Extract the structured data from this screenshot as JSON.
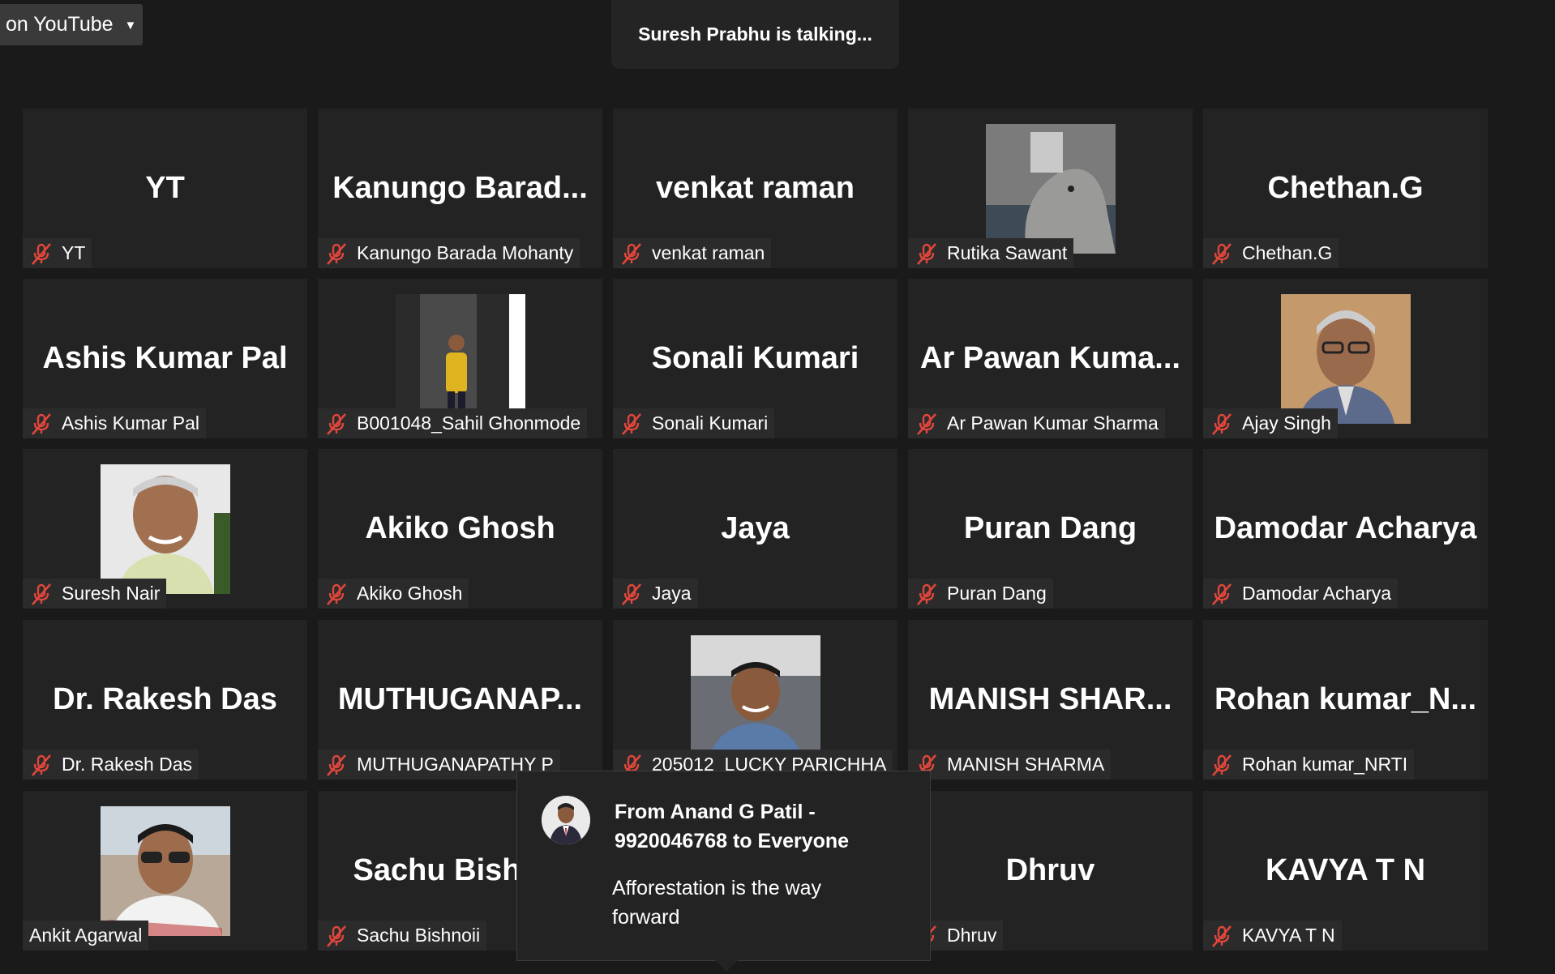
{
  "live_stream": {
    "label": "on YouTube"
  },
  "speaker": {
    "text": "Suresh Prabhu is talking..."
  },
  "tiles": [
    {
      "big": "YT",
      "label": "YT"
    },
    {
      "big": "Kanungo  Barad...",
      "label": "Kanungo Barada Mohanty"
    },
    {
      "big": "venkat raman",
      "label": "venkat raman"
    },
    {
      "big": "",
      "label": "Rutika Sawant"
    },
    {
      "big": "Chethan.G",
      "label": "Chethan.G"
    },
    {
      "big": "Ashis Kumar Pal",
      "label": "Ashis Kumar Pal"
    },
    {
      "big": "",
      "label": "B001048_Sahil Ghonmode"
    },
    {
      "big": "Sonali Kumari",
      "label": "Sonali Kumari"
    },
    {
      "big": "Ar  Pawan  Kuma...",
      "label": "Ar Pawan Kumar Sharma"
    },
    {
      "big": "",
      "label": "Ajay Singh"
    },
    {
      "big": "",
      "label": "Suresh Nair"
    },
    {
      "big": "Akiko  Ghosh",
      "label": "Akiko  Ghosh"
    },
    {
      "big": "Jaya",
      "label": "Jaya"
    },
    {
      "big": "Puran Dang",
      "label": "Puran Dang"
    },
    {
      "big": "Damodar Acharya",
      "label": "Damodar Acharya"
    },
    {
      "big": "Dr. Rakesh Das",
      "label": "Dr. Rakesh Das"
    },
    {
      "big": "MUTHUGANAP...",
      "label": "MUTHUGANAPATHY P"
    },
    {
      "big": "",
      "label": "205012_LUCKY PARICHHA"
    },
    {
      "big": "MANISH  SHAR...",
      "label": "MANISH SHARMA"
    },
    {
      "big": "Rohan  kumar_N...",
      "label": "Rohan kumar_NRTI"
    },
    {
      "big": "",
      "label": "Ankit Agarwal"
    },
    {
      "big": "Sachu Bishnoi",
      "label": "Sachu Bishnoii"
    },
    {
      "big": "",
      "label": ""
    },
    {
      "big": "Dhruv",
      "label": "Dhruv"
    },
    {
      "big": "KAVYA T N",
      "label": "KAVYA T N"
    }
  ],
  "chat": {
    "from": "From Anand G Patil - 9920046768 to Everyone",
    "message": "Afforestation is the way forward"
  },
  "colors": {
    "background": "#1a1a1a",
    "tile": "#232323",
    "mute": "#e0463b"
  }
}
